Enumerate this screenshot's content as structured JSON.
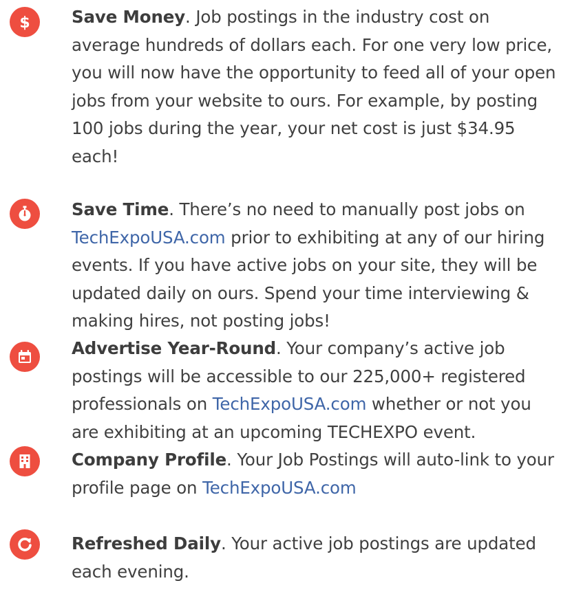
{
  "accent_color": "#ee4e40",
  "link_color": "#3f66a8",
  "benefits": [
    {
      "icon": "dollar-icon",
      "title": "Save Money",
      "text": ". Job postings in the industry cost on average hundreds of dollars each. For one very low price, you will now have the opportunity to feed all of your open jobs from your website to ours. For example, by posting 100 jobs during the year, your net cost is just $34.95 each!"
    },
    {
      "icon": "stopwatch-icon",
      "title": "Save Time",
      "text_before": ". There’s no need to manually post jobs on ",
      "link": "TechExpoUSA.com",
      "text_after": " prior to exhibiting at any of our hiring events. If you have active jobs on your site, they will be updated daily on ours.  Spend your time interviewing & making hires, not posting jobs!"
    },
    {
      "icon": "calendar-icon",
      "title": "Advertise Year-Round",
      "text_before": ". Your company’s active job postings will be accessible to our 225,000+ registered professionals on ",
      "link": "TechExpoUSA.com",
      "text_after": " whether or not you are exhibiting at an upcoming TECHEXPO event."
    },
    {
      "icon": "building-icon",
      "title": "Company Profile",
      "text_before": ". Your Job Postings will auto-link to your profile page on ",
      "link": "TechExpoUSA.com",
      "text_after": ""
    },
    {
      "icon": "refresh-icon",
      "title": "Refreshed Daily",
      "text": ". Your active job postings are updated each evening."
    }
  ]
}
